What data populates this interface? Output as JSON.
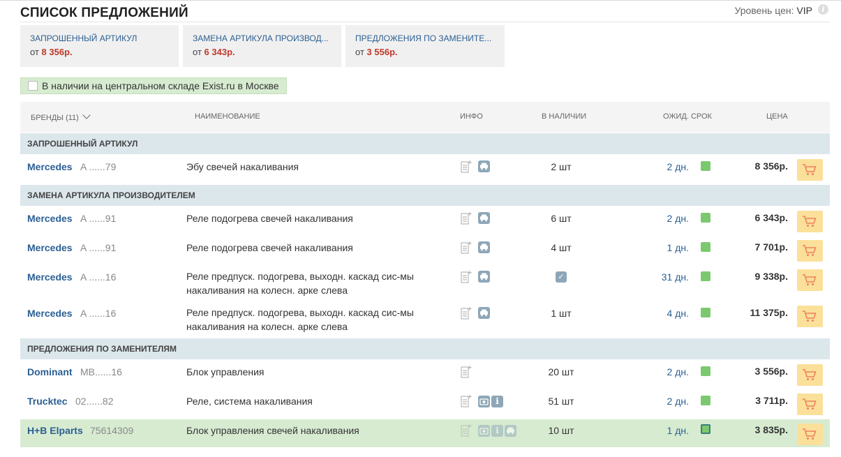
{
  "header": {
    "title": "СПИСОК ПРЕДЛОЖЕНИЙ",
    "price_level_label": "Уровень цен:",
    "price_level_value": "VIP",
    "info_glyph": "i"
  },
  "cards": [
    {
      "title": "ЗАПРОШЕННЫЙ АРТИКУЛ",
      "from": "от",
      "price": "8 356р."
    },
    {
      "title": "ЗАМЕНА АРТИКУЛА ПРОИЗВОД...",
      "from": "от",
      "price": "6 343р."
    },
    {
      "title": "ПРЕДЛОЖЕНИЯ ПО ЗАМЕНИТЕ...",
      "from": "от",
      "price": "3 556р."
    }
  ],
  "filter": {
    "stock_label": "В наличии на центральном складе Exist.ru в Москве",
    "checked": false
  },
  "columns": {
    "brands": "БРЕНДЫ (11)",
    "name": "НАИМЕНОВАНИЕ",
    "info": "ИНФО",
    "stock": "В НАЛИЧИИ",
    "term": "ОЖИД. СРОК",
    "price": "ЦЕНА"
  },
  "sections": [
    "ЗАПРОШЕННЫЙ АРТИКУЛ",
    "ЗАМЕНА АРТИКУЛА ПРОИЗВОДИТЕЛЕМ",
    "ПРЕДЛОЖЕНИЯ ПО ЗАМЕНИТЕЛЯМ"
  ],
  "rows": [
    {
      "brand": "Mercedes",
      "article": "A ......79",
      "name": "Эбу свечей накаливания",
      "qty": "2 шт",
      "days": "2 дн.",
      "price": "8 356р.",
      "icons": [
        "doc-icon",
        "car-icon"
      ]
    },
    {
      "brand": "Mercedes",
      "article": "A ......91",
      "name": "Реле подогрева свечей накаливания",
      "qty": "6 шт",
      "days": "2 дн.",
      "price": "6 343р.",
      "icons": [
        "doc-icon",
        "car-icon"
      ]
    },
    {
      "brand": "Mercedes",
      "article": "A ......91",
      "name": "Реле подогрева свечей накаливания",
      "qty": "4 шт",
      "days": "1 дн.",
      "price": "7 701р.",
      "icons": [
        "doc-icon",
        "car-icon"
      ]
    },
    {
      "brand": "Mercedes",
      "article": "A ......16",
      "name": "Реле предпуск. подогрева, выходн. каскад сис-мы накаливания на колесн. арке слева",
      "qty": "",
      "qty_check": "✓",
      "days": "31 дн.",
      "price": "9 338р.",
      "icons": [
        "doc-icon",
        "car-icon"
      ]
    },
    {
      "brand": "Mercedes",
      "article": "A ......16",
      "name": "Реле предпуск. подогрева, выходн. каскад сис-мы накаливания на колесн. арке слева",
      "qty": "1 шт",
      "days": "4 дн.",
      "price": "11 375р.",
      "icons": [
        "doc-icon",
        "car-icon"
      ]
    },
    {
      "brand": "Dominant",
      "article": "MB......16",
      "name": "Блок управления",
      "qty": "20 шт",
      "days": "2 дн.",
      "price": "3 556р.",
      "icons": [
        "doc-icon"
      ]
    },
    {
      "brand": "Trucktec",
      "article": "02......82",
      "name": "Реле, система накаливания",
      "qty": "51 шт",
      "days": "2 дн.",
      "price": "3 711р.",
      "icons": [
        "doc-icon",
        "camera-icon",
        "info-icon"
      ]
    },
    {
      "brand": "H+B Elparts",
      "article": "75614309",
      "name": "Блок управления свечей накаливания",
      "qty": "10 шт",
      "days": "1 дн.",
      "price": "3 835р.",
      "icons": [
        "doc-icon",
        "camera-icon",
        "info-icon",
        "car-icon"
      ],
      "highlight": true
    }
  ],
  "colors": {
    "link": "#2b5f93",
    "price_accent": "#c0392b",
    "section_bg": "#dce7ec",
    "highlight_bg": "#d7ebd1",
    "cart_bg": "#fbe09a",
    "status_ok": "#7bc96f"
  }
}
